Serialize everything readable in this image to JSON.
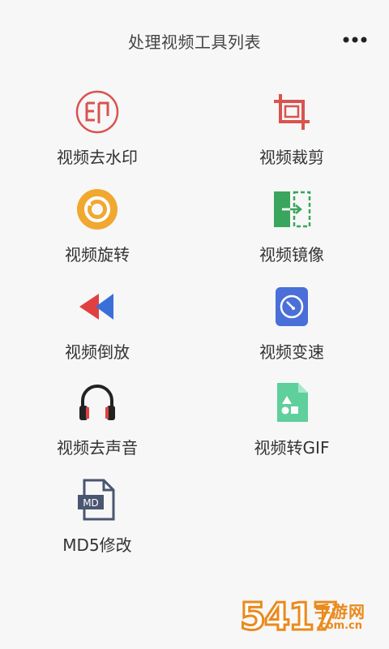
{
  "header": {
    "title": "处理视频工具列表",
    "more_icon": "more-dots-icon"
  },
  "tools": [
    {
      "label": "视频去水印",
      "icon": "watermark-remove-icon",
      "color": "#d9534f"
    },
    {
      "label": "视频裁剪",
      "icon": "crop-icon",
      "color": "#d9534f"
    },
    {
      "label": "视频旋转",
      "icon": "rotate-icon",
      "color": "#f0a830"
    },
    {
      "label": "视频镜像",
      "icon": "mirror-icon",
      "color": "#3aa55c"
    },
    {
      "label": "视频倒放",
      "icon": "rewind-icon",
      "color": "#e04040"
    },
    {
      "label": "视频变速",
      "icon": "speed-dial-icon",
      "color": "#4a6fd8"
    },
    {
      "label": "视频去声音",
      "icon": "headphones-icon",
      "color": "#222222"
    },
    {
      "label": "视频转GIF",
      "icon": "gif-file-icon",
      "color": "#5fcf9c"
    },
    {
      "label": "MD5修改",
      "icon": "md-file-icon",
      "color": "#4a5670"
    }
  ],
  "watermark": {
    "number": "5417",
    "cn_text": "手游网",
    "url": ".com.cn"
  }
}
